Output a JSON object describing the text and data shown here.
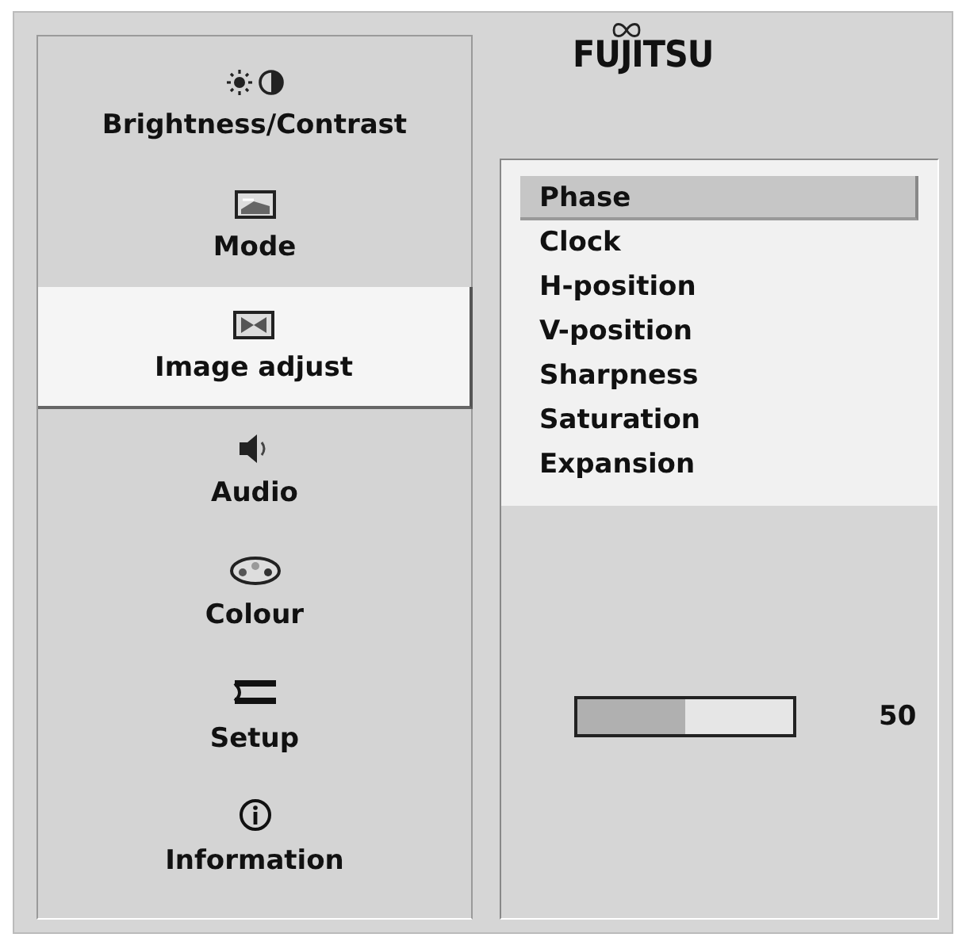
{
  "menu": [
    {
      "label": "Brightness/Contrast",
      "selected": false
    },
    {
      "label": "Mode",
      "selected": false
    },
    {
      "label": "Image adjust",
      "selected": true
    },
    {
      "label": "Audio",
      "selected": false
    },
    {
      "label": "Colour",
      "selected": false
    },
    {
      "label": "Setup",
      "selected": false
    },
    {
      "label": "Information",
      "selected": false
    }
  ],
  "logo": "FUJITSU",
  "options": [
    {
      "label": "Phase",
      "selected": true
    },
    {
      "label": "Clock",
      "selected": false
    },
    {
      "label": "H-position",
      "selected": false
    },
    {
      "label": "V-position",
      "selected": false
    },
    {
      "label": "Sharpness",
      "selected": false
    },
    {
      "label": "Saturation",
      "selected": false
    },
    {
      "label": "Expansion",
      "selected": false
    }
  ],
  "slider": {
    "level": 0.5,
    "reading": "50"
  }
}
